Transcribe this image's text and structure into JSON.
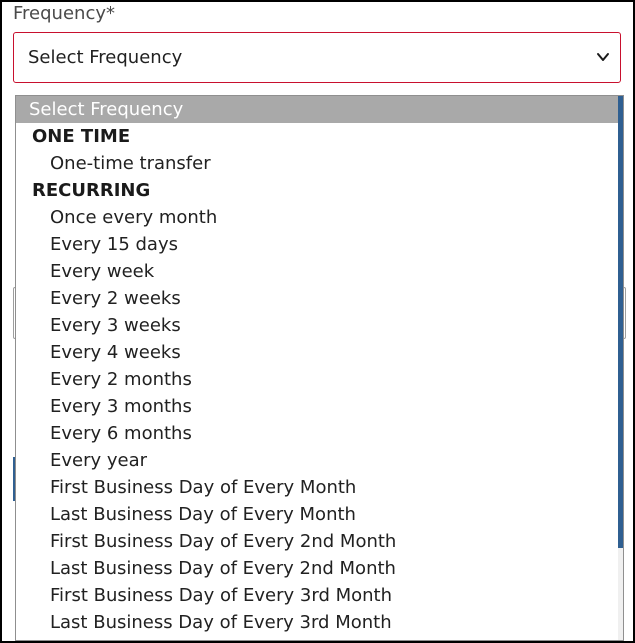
{
  "field": {
    "label": "Frequency*",
    "selected_value": "Select Frequency",
    "chevron_icon": "chevron-down-icon",
    "accent_color": "#c8102e"
  },
  "dropdown": {
    "placeholder": "Select Frequency",
    "groups": [
      {
        "label": "ONE TIME",
        "options": [
          "One-time transfer"
        ]
      },
      {
        "label": "RECURRING",
        "options": [
          "Once every month",
          "Every 15 days",
          "Every week",
          "Every 2 weeks",
          "Every 3 weeks",
          "Every 4 weeks",
          "Every 2 months",
          "Every 3 months",
          "Every 6 months",
          "Every year",
          "First Business Day of Every Month",
          "Last Business Day of Every Month",
          "First Business Day of Every 2nd Month",
          "Last Business Day of Every 2nd Month",
          "First Business Day of Every 3rd Month",
          "Last Business Day of Every 3rd Month"
        ]
      }
    ],
    "scrollbar_color": "#2f5f91",
    "placeholder_bg": "#a9a9a9"
  }
}
